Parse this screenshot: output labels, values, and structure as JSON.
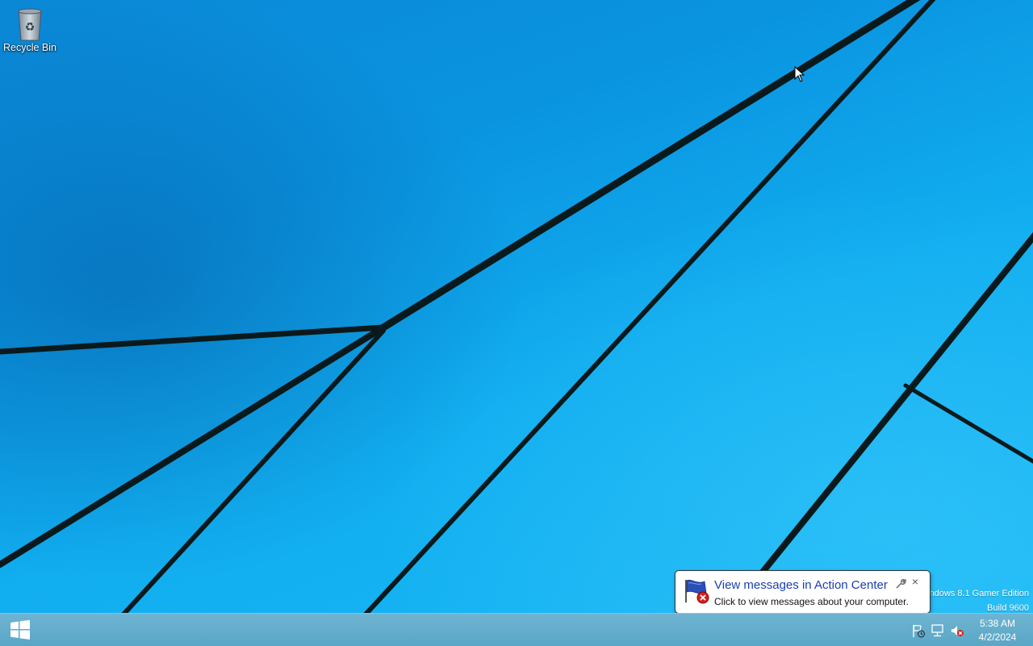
{
  "desktop": {
    "icons": [
      {
        "label": "Recycle Bin",
        "icon": "recycle-bin-icon"
      }
    ],
    "watermark": {
      "line1": "ndows 8.1 Gamer Edition",
      "line2": "Build 9600"
    }
  },
  "balloon": {
    "title": "View messages in Action Center",
    "body": "Click to view messages about your computer.",
    "icon": "action-center-flag-icon",
    "close_label": "×"
  },
  "taskbar": {
    "start_icon": "windows-logo-icon",
    "tray_icons": [
      "action-center-flag-icon",
      "network-icon",
      "volume-muted-icon"
    ],
    "clock": {
      "time": "5:38 AM",
      "date": "4/2/2024"
    }
  },
  "colors": {
    "desktop_blue": "#0a94e0",
    "taskbar": "#5aa6c6",
    "balloon_title": "#1a3fb0"
  }
}
